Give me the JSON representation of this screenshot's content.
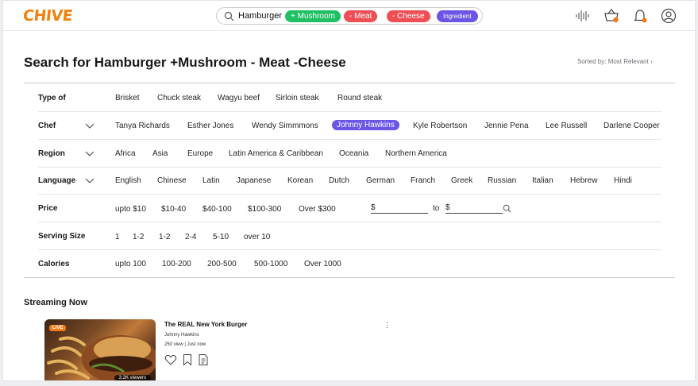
{
  "header": {
    "logo": "CHIVE",
    "search_term": "Hamburger",
    "chips": {
      "mushroom": "+ Mushroom",
      "meat": "- Meat",
      "cheese": "- Cheese",
      "ingredient": "Ingredient"
    }
  },
  "page": {
    "title": "Search for Hamburger +Mushroom - Meat -Cheese",
    "sorted_by": "Sorted by: Most Relevant ›"
  },
  "filters": {
    "type_of": {
      "label": "Type of",
      "options": [
        "Brisket",
        "Chuck steak",
        "Wagyu beef",
        "Sirloin steak",
        "Round steak"
      ]
    },
    "chef": {
      "label": "Chef",
      "options": [
        "Tanya Richards",
        "Esther Jones",
        "Wendy Simmmons",
        "Johnny Hawkins",
        "Kyle Robertson",
        "Jennie Pena",
        "Lee Russell",
        "Darlene Cooper"
      ],
      "selected": "Johnny Hawkins"
    },
    "region": {
      "label": "Region",
      "options": [
        "Africa",
        "Asia",
        "Europe",
        "Latin America & Caribbean",
        "Oceania",
        "Northern America"
      ]
    },
    "language": {
      "label": "Language",
      "options": [
        "English",
        "Chinese",
        "Latin",
        "Japanese",
        "Korean",
        "Dutch",
        "German",
        "Franch",
        "Greek",
        "Russian",
        "Italian",
        "Hebrew",
        "Hindi"
      ]
    },
    "price": {
      "label": "Price",
      "options": [
        "upto $10",
        "$10-40",
        "$40-100",
        "$100-300",
        "Over $300"
      ],
      "from_prefix": "$",
      "to_label": "to",
      "to_prefix": "$"
    },
    "serving_size": {
      "label": "Serving Size",
      "options": [
        "1",
        "1-2",
        "1-2",
        "2-4",
        "5-10",
        "over 10"
      ]
    },
    "calories": {
      "label": "Calories",
      "options": [
        "upto 100",
        "100-200",
        "200-500",
        "500-1000",
        "Over 1000"
      ]
    }
  },
  "streaming": {
    "heading": "Streaming Now",
    "card": {
      "live_badge": "LIVE",
      "viewers": "3.2K viewers",
      "title": "The REAL New York Burger",
      "author": "Johnny Hawkins",
      "meta": "250 view | Just now"
    }
  },
  "colors": {
    "brand": "#f0820f",
    "chip_green": "#1fbf63",
    "chip_red": "#ef4f54",
    "chip_purple": "#6a55e6",
    "notification_dot": "#f07b19"
  },
  "icons": [
    "search-icon",
    "voice-wave-icon",
    "basket-icon",
    "bell-icon",
    "profile-icon",
    "chevron-down-icon",
    "heart-icon",
    "bookmark-icon",
    "document-icon",
    "more-vertical-icon"
  ]
}
